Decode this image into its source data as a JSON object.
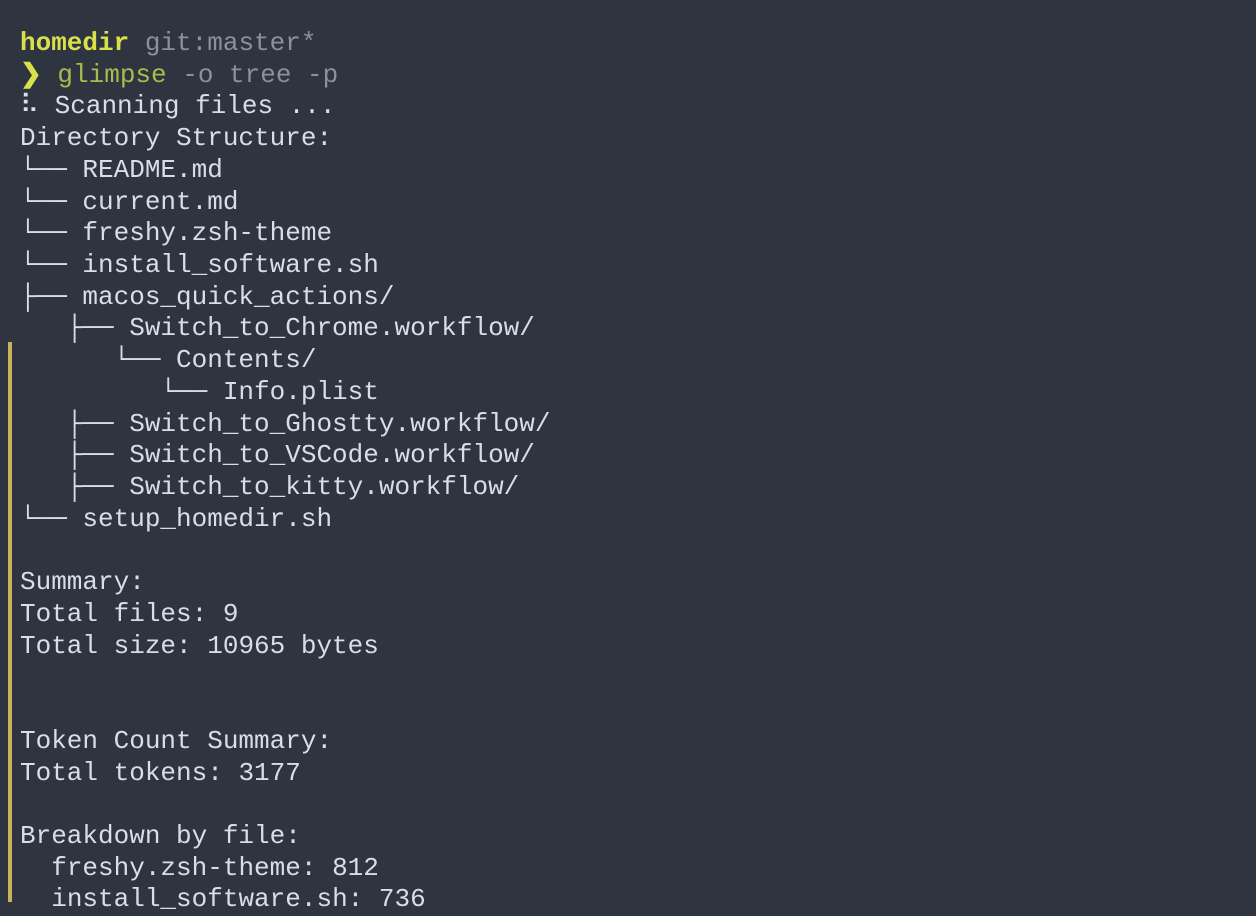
{
  "prompt": {
    "directory": "homedir",
    "git_prefix": " git",
    "git_colon": ":",
    "git_branch": "master",
    "git_dirty": "*",
    "arrow": "❯",
    "command": "glimpse",
    "args": " -o tree -p"
  },
  "scanning": {
    "spinner": "⠧",
    "text": " Scanning files ..."
  },
  "tree": {
    "header": "Directory Structure:",
    "lines": [
      "└── README.md",
      "└── current.md",
      "└── freshy.zsh-theme",
      "└── install_software.sh",
      "├── macos_quick_actions/",
      "   ├── Switch_to_Chrome.workflow/",
      "      └── Contents/",
      "         └── Info.plist",
      "   ├── Switch_to_Ghostty.workflow/",
      "   ├── Switch_to_VSCode.workflow/",
      "   ├── Switch_to_kitty.workflow/",
      "└── setup_homedir.sh"
    ]
  },
  "summary": {
    "header": "Summary:",
    "files_label": "Total files: ",
    "files_value": "9",
    "size_label": "Total size: ",
    "size_value": "10965 bytes"
  },
  "tokens": {
    "header": "Token Count Summary:",
    "total_label": "Total tokens: ",
    "total_value": "3177"
  },
  "breakdown": {
    "header": "Breakdown by file:",
    "items": [
      {
        "name": "freshy.zsh-theme",
        "value": "812"
      },
      {
        "name": "install_software.sh",
        "value": "736"
      }
    ]
  }
}
